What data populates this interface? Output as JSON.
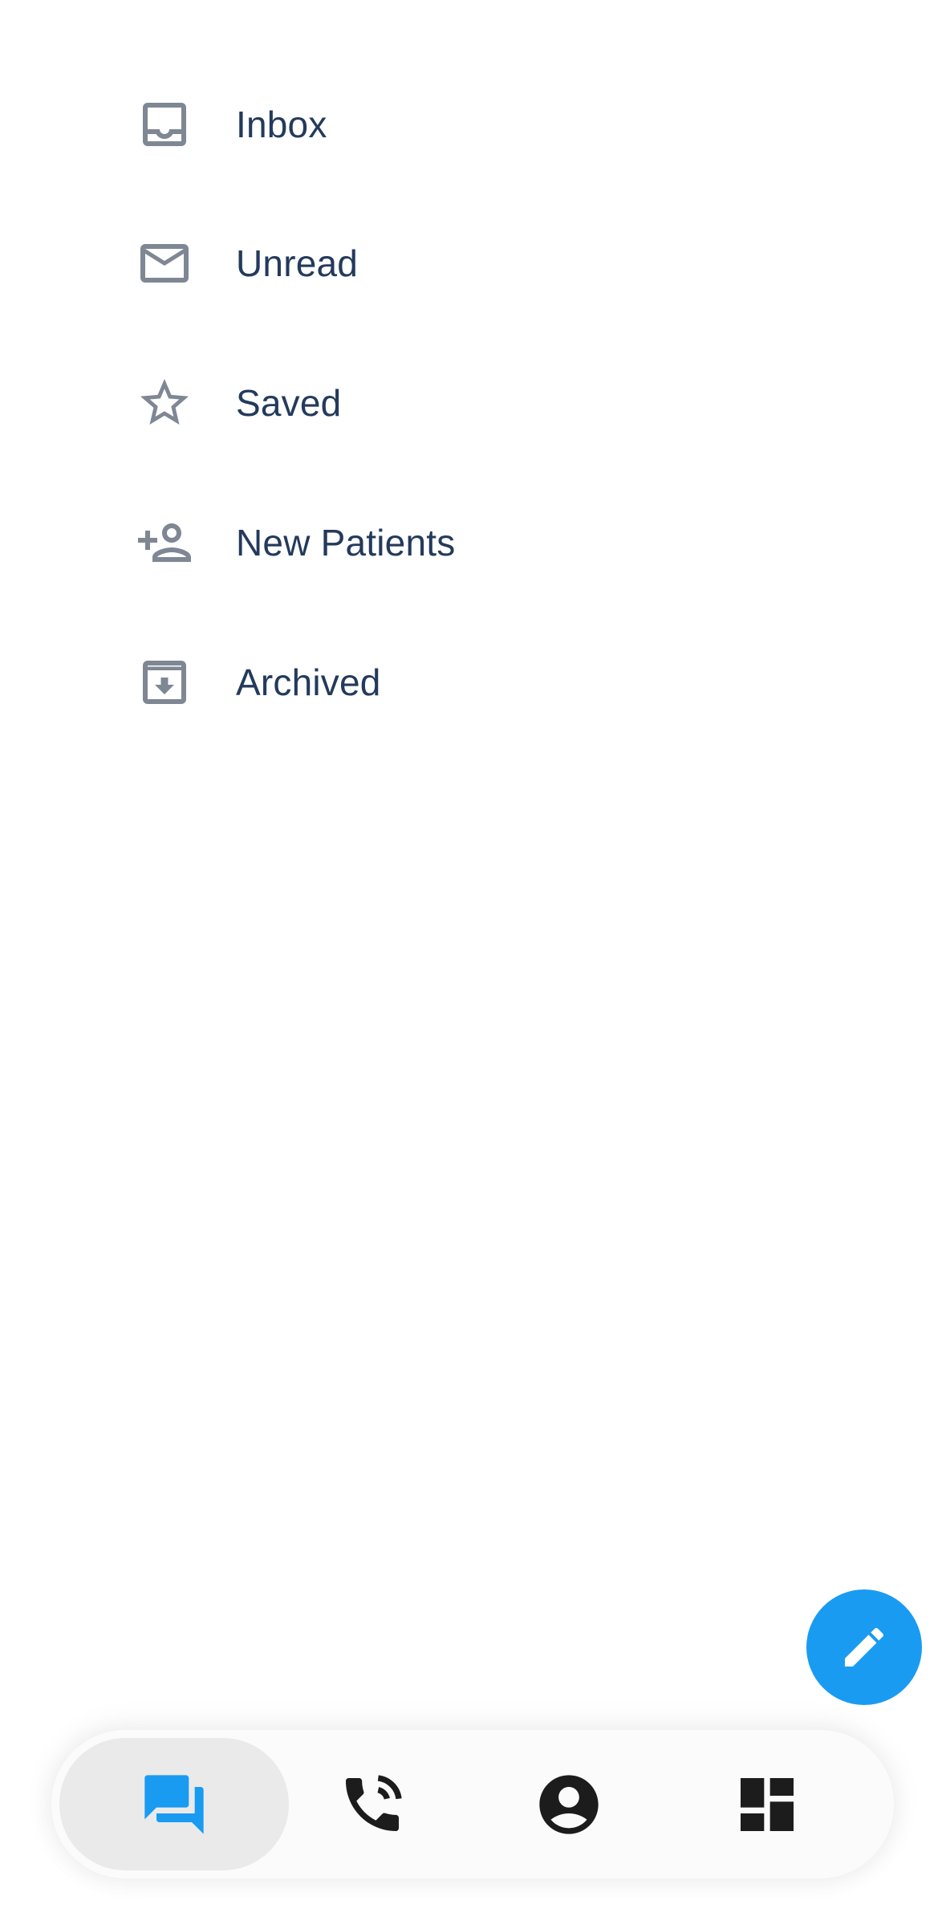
{
  "menu": {
    "items": [
      {
        "label": "Inbox",
        "icon": "inbox-icon"
      },
      {
        "label": "Unread",
        "icon": "mail-icon"
      },
      {
        "label": "Saved",
        "icon": "star-icon"
      },
      {
        "label": "New Patients",
        "icon": "person-add-icon"
      },
      {
        "label": "Archived",
        "icon": "archive-icon"
      }
    ]
  },
  "fab": {
    "icon": "pencil-icon"
  },
  "bottom_nav": {
    "items": [
      {
        "icon": "chat-icon",
        "active": true
      },
      {
        "icon": "phone-callback-icon",
        "active": false
      },
      {
        "icon": "account-icon",
        "active": false
      },
      {
        "icon": "dashboard-icon",
        "active": false
      }
    ]
  },
  "colors": {
    "accent": "#1a9bf2",
    "text": "#233a5c",
    "icon_gray": "#7f8794",
    "nav_icon": "#1c1c1c",
    "active_pill": "#eaeaea"
  }
}
